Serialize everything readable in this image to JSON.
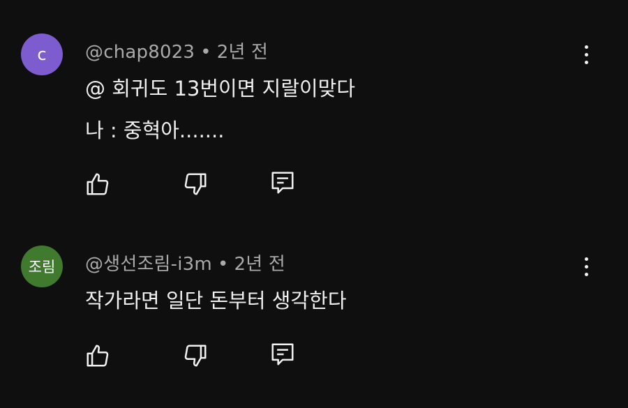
{
  "comments": [
    {
      "avatar_text": "c",
      "avatar_color": "#7c5ccf",
      "author": "@chap8023",
      "separator": "•",
      "time": "2년 전",
      "lines": [
        "@ 회귀도 13번이면 지랄이맞다",
        "나 : 중혁아......."
      ],
      "like_icon": "thumb-up-icon",
      "dislike_icon": "thumb-down-icon",
      "reply_icon": "reply-icon",
      "more_icon": "more-vertical-icon"
    },
    {
      "avatar_text": "조림",
      "avatar_color": "#3f7a2e",
      "author": "@생선조림-i3m",
      "separator": "•",
      "time": "2년 전",
      "lines": [
        "작가라면 일단 돈부터 생각한다"
      ],
      "like_icon": "thumb-up-icon",
      "dislike_icon": "thumb-down-icon",
      "reply_icon": "reply-icon",
      "more_icon": "more-vertical-icon"
    }
  ]
}
